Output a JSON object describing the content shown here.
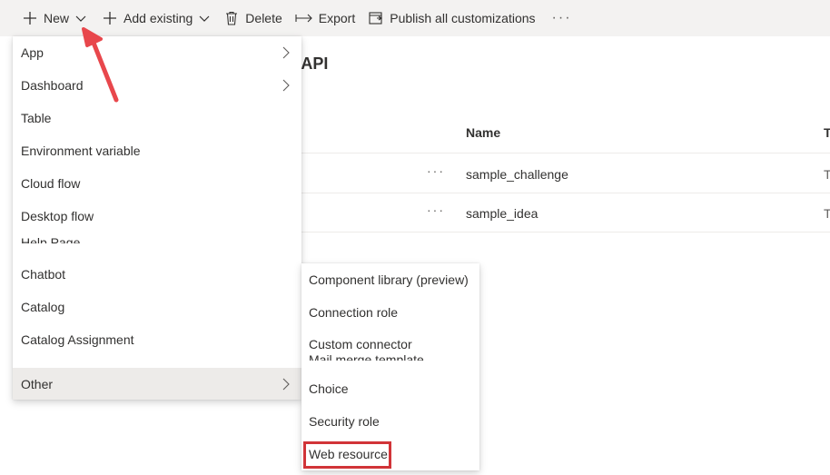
{
  "toolbar": {
    "new_label": "New",
    "add_existing_label": "Add existing",
    "delete_label": "Delete",
    "export_label": "Export",
    "publish_label": "Publish all customizations",
    "more_label": "···"
  },
  "page": {
    "title_partial": "b API"
  },
  "grid": {
    "columns": [
      "Name",
      "T"
    ],
    "rows": [
      {
        "more": "···",
        "name": "sample_challenge",
        "type": "Ta"
      },
      {
        "more": "···",
        "name": "sample_idea",
        "type": "Ta"
      }
    ]
  },
  "new_menu": {
    "items": [
      {
        "label": "App",
        "has_submenu": true
      },
      {
        "label": "Dashboard",
        "has_submenu": true
      },
      {
        "label": "Table",
        "has_submenu": false
      },
      {
        "label": "Environment variable",
        "has_submenu": false
      },
      {
        "label": "Cloud flow",
        "has_submenu": false
      },
      {
        "label": "Desktop flow",
        "has_submenu": false
      },
      {
        "label": "Chatbot",
        "has_submenu": false
      },
      {
        "label": "Catalog",
        "has_submenu": false
      },
      {
        "label": "Catalog Assignment",
        "has_submenu": false
      },
      {
        "label": "Other",
        "has_submenu": true
      }
    ],
    "clipped_item": "Help Page"
  },
  "other_submenu": {
    "items": [
      {
        "label": "Component library (preview)"
      },
      {
        "label": "Connection role"
      },
      {
        "label": "Custom connector"
      },
      {
        "label": "Choice"
      },
      {
        "label": "Security role"
      },
      {
        "label": "Web resource"
      }
    ],
    "clipped_item": "Mail merge template",
    "highlighted": "Web resource"
  },
  "colors": {
    "annotation": "#e8474c",
    "highlight_border": "#d13438",
    "toolbar_bg": "#f3f2f1",
    "active_item_bg": "#edebe9"
  },
  "icons": [
    "plus-icon",
    "chevron-down-icon",
    "trash-icon",
    "export-icon",
    "publish-icon",
    "chevron-right-icon",
    "red-arrow"
  ]
}
